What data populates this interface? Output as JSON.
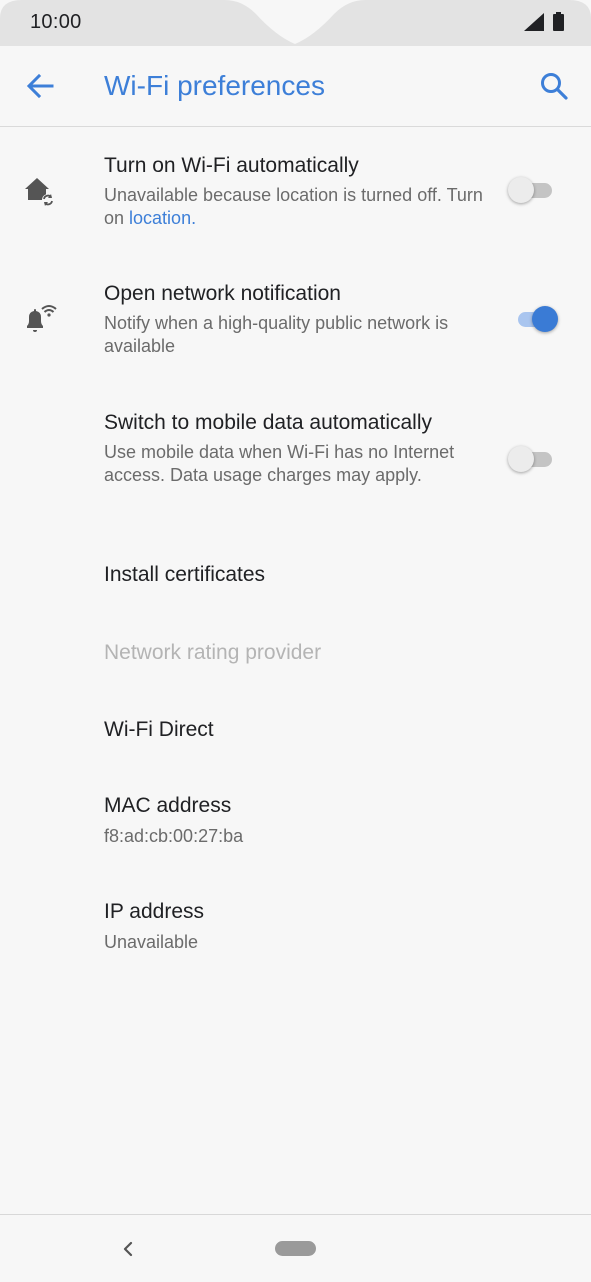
{
  "status_bar": {
    "time": "10:00",
    "signal_icon": "signal-icon",
    "battery_icon": "battery-icon"
  },
  "app_bar": {
    "title": "Wi-Fi preferences",
    "back_icon": "arrow-back-icon",
    "search_icon": "search-icon"
  },
  "items": [
    {
      "title": "Turn on Wi-Fi automatically",
      "summary_prefix": "Unavailable because location is turned off. Turn on ",
      "summary_link": "location",
      "summary_suffix": ".",
      "icon": "home-sync-icon",
      "toggle": false
    },
    {
      "title": "Open network notification",
      "summary": "Notify when a high-quality public network is available",
      "icon": "bell-wifi-icon",
      "toggle": true
    },
    {
      "title": "Switch to mobile data automatically",
      "summary": "Use mobile data when Wi-Fi has no Internet access. Data usage charges may apply.",
      "toggle": false
    },
    {
      "title": "Install certificates"
    },
    {
      "title": "Network rating provider",
      "disabled": true
    },
    {
      "title": "Wi-Fi Direct"
    },
    {
      "title": "MAC address",
      "summary": "f8:ad:cb:00:27:ba"
    },
    {
      "title": "IP address",
      "summary": "Unavailable"
    }
  ],
  "nav_bar": {
    "back_icon": "nav-back-icon",
    "home_icon": "nav-home-pill"
  },
  "colors": {
    "accent": "#3d7fd8",
    "background": "#f7f7f7",
    "status_bar": "#e3e3e3"
  }
}
